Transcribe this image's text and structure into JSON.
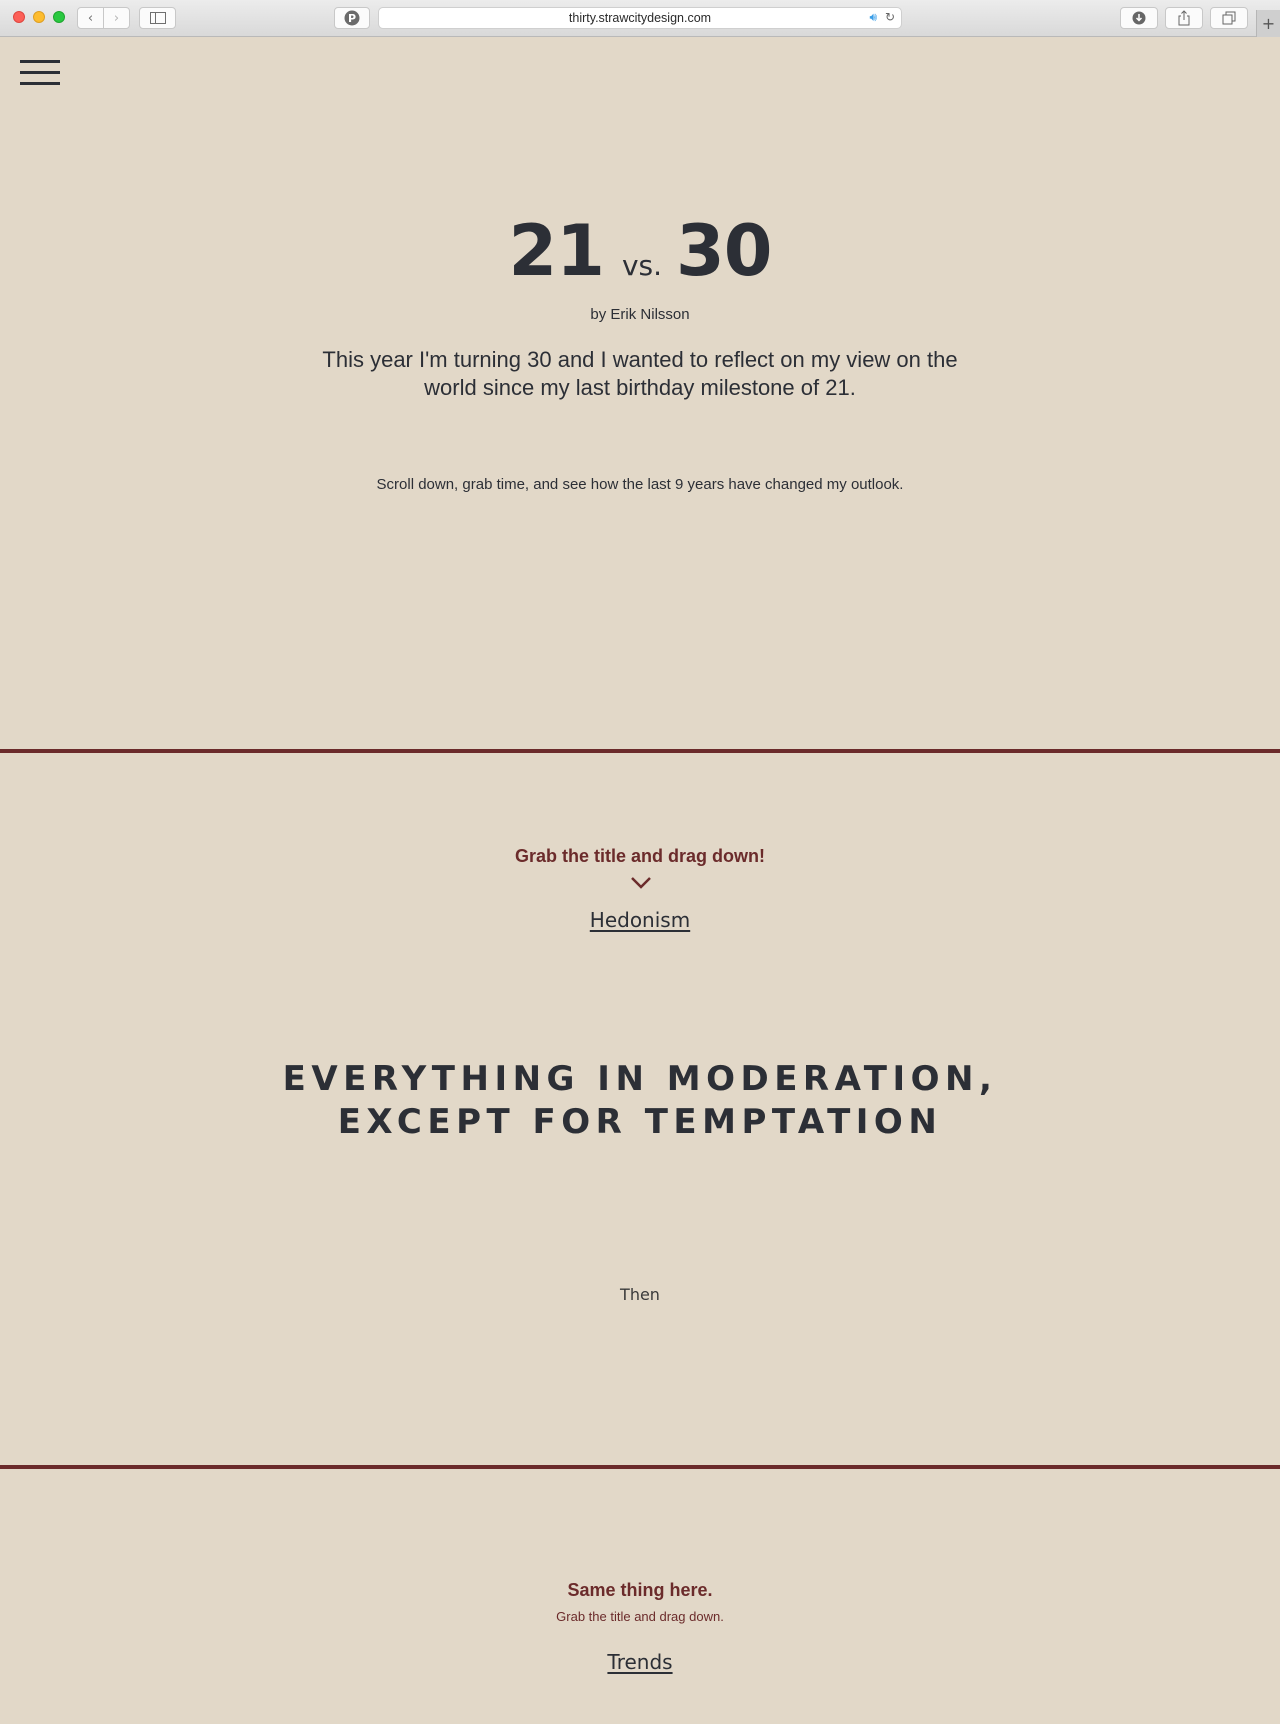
{
  "browser": {
    "url": "thirty.strawcitydesign.com",
    "icons": [
      "back-icon",
      "forward-icon",
      "sidebar-icon",
      "pinterest-icon",
      "audio-icon",
      "reload-icon",
      "download-icon",
      "share-icon",
      "tabs-icon",
      "new-tab-icon"
    ]
  },
  "hero": {
    "num_left": "21",
    "vs": "vs.",
    "num_right": "30",
    "byline": "by Erik Nilsson",
    "intro": "This year I'm turning 30 and I wanted to reflect on my view on the world since my last birthday milestone of 21.",
    "scroll_note": "Scroll down, grab time, and see how the last 9 years have changed my outlook."
  },
  "section1": {
    "instruction": "Grab the title and drag down!",
    "title": "Hedonism",
    "quote_line1": "EVERYTHING IN MODERATION,",
    "quote_line2": "EXCEPT FOR TEMPTATION",
    "label": "Then"
  },
  "section2": {
    "instruction": "Same thing here.",
    "sub_instruction": "Grab the title and drag down.",
    "title": "Trends"
  },
  "colors": {
    "background": "#e2d8c8",
    "text": "#2c2f36",
    "accent": "#6b2b2b"
  }
}
